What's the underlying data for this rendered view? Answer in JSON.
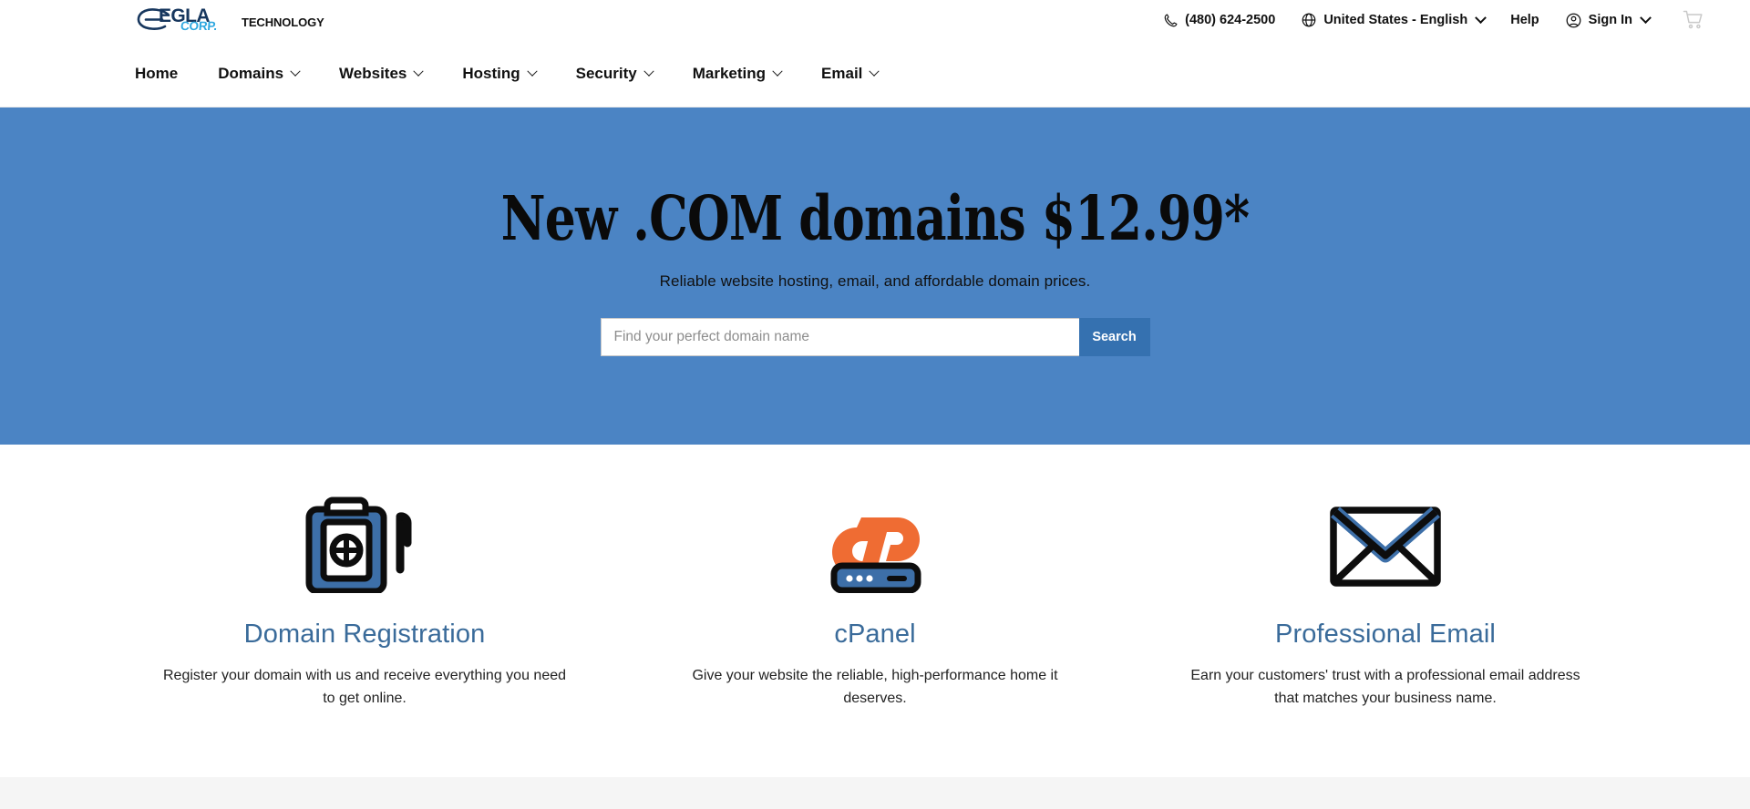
{
  "brand": {
    "logo_e": "e-swoosh-logo",
    "logo_primary": "EGLA",
    "logo_secondary": "CORP.",
    "logo_suffix": "TECHNOLOGY"
  },
  "utility": {
    "phone": "(480) 624-2500",
    "locale": "United States - English",
    "help": "Help",
    "sign_in": "Sign In",
    "cart": "cart-icon"
  },
  "nav": {
    "items": [
      {
        "label": "Home",
        "has_chevron": false
      },
      {
        "label": "Domains",
        "has_chevron": true
      },
      {
        "label": "Websites",
        "has_chevron": true
      },
      {
        "label": "Hosting",
        "has_chevron": true
      },
      {
        "label": "Security",
        "has_chevron": true
      },
      {
        "label": "Marketing",
        "has_chevron": true
      },
      {
        "label": "Email",
        "has_chevron": true
      }
    ]
  },
  "hero": {
    "title": "New .COM domains $12.99*",
    "subtitle": "Reliable website hosting, email, and affordable domain prices.",
    "search_placeholder": "Find your perfect domain name",
    "search_value": "",
    "search_button": "Search",
    "background_color": "#4b84c4",
    "button_color": "#3571b0"
  },
  "features": [
    {
      "icon": "domain-registration-icon",
      "title": "Domain Registration",
      "description": "Register your domain with us and receive everything you need to get online."
    },
    {
      "icon": "cpanel-icon",
      "title": "cPanel",
      "description": "Give your website the reliable, high-performance home it deserves."
    },
    {
      "icon": "professional-email-icon",
      "title": "Professional Email",
      "description": "Earn your customers' trust with a professional email address that matches your business name."
    }
  ],
  "colors": {
    "hero_blue": "#4b84c4",
    "feature_title_blue": "#3a6b9a",
    "logo_navy": "#17375e",
    "logo_cyan": "#2fa8e0",
    "cpanel_orange": "#ef6c33",
    "icon_blue": "#3d6fa8"
  }
}
